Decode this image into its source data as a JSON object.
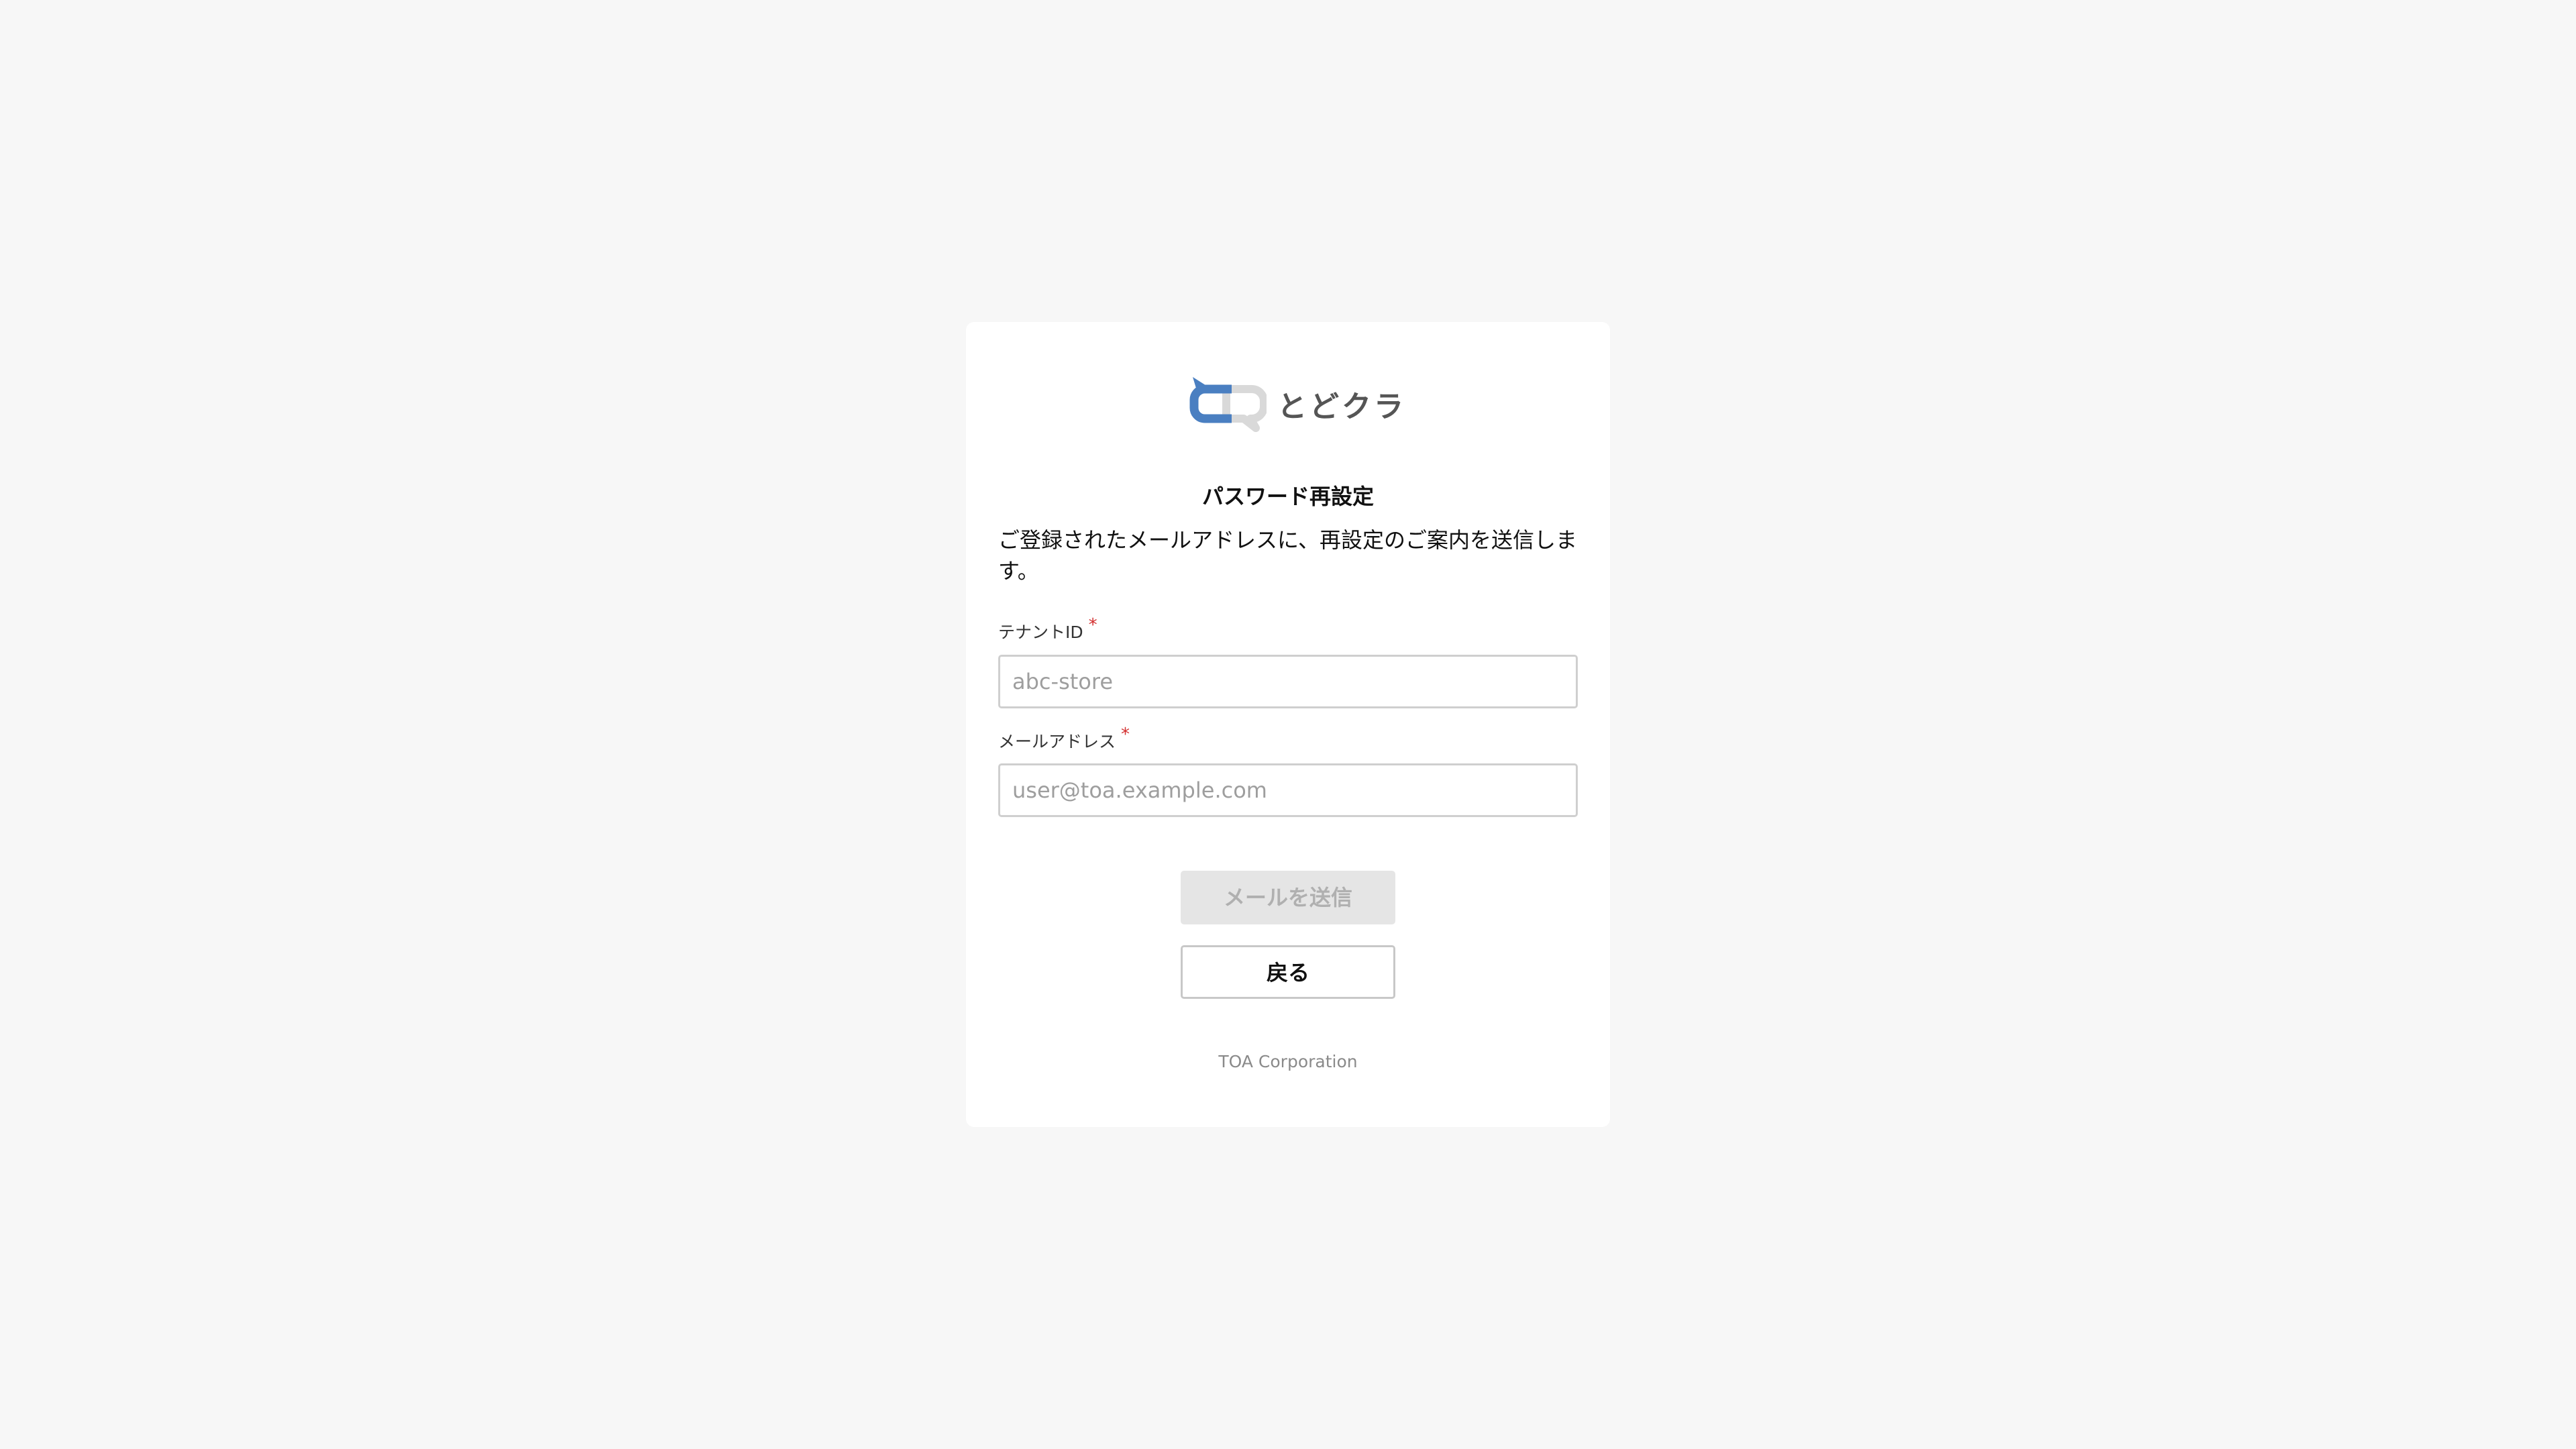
{
  "brand": {
    "name": "とどクラ",
    "logo_icon": "speech-bubbles-logo-icon",
    "colors": {
      "primary": "#4a7fc1",
      "secondary": "#d9d9d9"
    }
  },
  "page": {
    "title": "パスワード再設定",
    "description": "ご登録されたメールアドレスに、再設定のご案内を送信します。"
  },
  "form": {
    "tenant": {
      "label": "テナントID",
      "required_mark": "*",
      "value": "",
      "placeholder": "abc-store"
    },
    "email": {
      "label": "メールアドレス",
      "required_mark": "*",
      "value": "",
      "placeholder": "user@toa.example.com"
    }
  },
  "actions": {
    "send_label": "メールを送信",
    "back_label": "戻る"
  },
  "footer": {
    "copyright": "TOA Corporation"
  }
}
